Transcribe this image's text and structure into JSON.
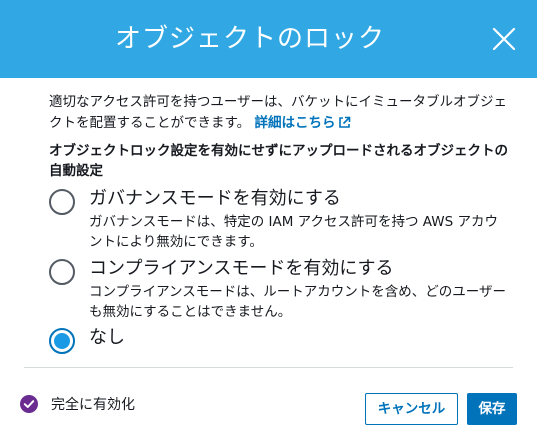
{
  "dialog": {
    "title": "オブジェクトのロック",
    "close_icon": "close-icon"
  },
  "intro": {
    "text": "適切なアクセス許可を持つユーザーは、バケットにイミュータブルオブジェクトを配置することができます。",
    "link_label": "詳細はこちら",
    "link_icon": "external-link-icon"
  },
  "section": {
    "label": "オブジェクトロック設定を有効にせずにアップロードされるオブジェクトの自動設定"
  },
  "options": [
    {
      "title": "ガバナンスモードを有効にする",
      "description": "ガバナンスモードは、特定の IAM アクセス許可を持つ AWS アカウントにより無効にできます。",
      "selected": false
    },
    {
      "title": "コンプライアンスモードを有効にする",
      "description": "コンプライアンスモードは、ルートアカウントを含め、どのユーザーも無効にすることはできません。",
      "selected": false
    },
    {
      "title": "なし",
      "description": "",
      "selected": true
    }
  ],
  "footer": {
    "status_text": "完全に有効化",
    "status_icon": "check-circle-icon",
    "cancel_label": "キャンセル",
    "save_label": "保存"
  },
  "colors": {
    "header": "#31a8e3",
    "accent": "#0073bb",
    "radio_selected": "#1a9ae4",
    "status_icon": "#6b2c91"
  }
}
